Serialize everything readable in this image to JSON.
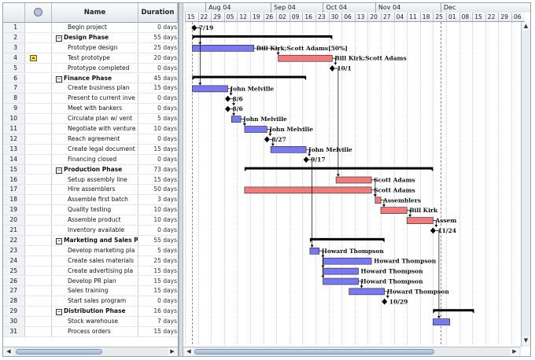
{
  "table": {
    "headers": {
      "name": "Name",
      "duration": "Duration",
      "info_icon": "info-icon"
    },
    "rows": [
      {
        "id": "1",
        "name": "Begin project",
        "duration": "0 days",
        "summary": false,
        "indent": 1,
        "note": false
      },
      {
        "id": "2",
        "name": "Design Phase",
        "duration": "55 days",
        "summary": true,
        "indent": 0,
        "note": false
      },
      {
        "id": "3",
        "name": "Prototype design",
        "duration": "25 days",
        "summary": false,
        "indent": 1,
        "note": false
      },
      {
        "id": "4",
        "name": "Test prototype",
        "duration": "20 days",
        "summary": false,
        "indent": 1,
        "note": true
      },
      {
        "id": "5",
        "name": "Prototype completed",
        "duration": "0 days",
        "summary": false,
        "indent": 1,
        "note": false
      },
      {
        "id": "6",
        "name": "Finance Phase",
        "duration": "45 days",
        "summary": true,
        "indent": 0,
        "note": false
      },
      {
        "id": "7",
        "name": "Create business plan",
        "duration": "15 days",
        "summary": false,
        "indent": 1,
        "note": false
      },
      {
        "id": "8",
        "name": "Present to current inve",
        "duration": "0 days",
        "summary": false,
        "indent": 1,
        "note": false
      },
      {
        "id": "9",
        "name": "Meet with bankers",
        "duration": "0 days",
        "summary": false,
        "indent": 1,
        "note": false
      },
      {
        "id": "10",
        "name": "Circulate plan w/ vent",
        "duration": "5 days",
        "summary": false,
        "indent": 1,
        "note": false
      },
      {
        "id": "11",
        "name": "Negotiate with venture",
        "duration": "10 days",
        "summary": false,
        "indent": 1,
        "note": false
      },
      {
        "id": "12",
        "name": "Reach agreement",
        "duration": "0 days",
        "summary": false,
        "indent": 1,
        "note": false
      },
      {
        "id": "13",
        "name": "Create legal document",
        "duration": "15 days",
        "summary": false,
        "indent": 1,
        "note": false
      },
      {
        "id": "14",
        "name": "Financing closed",
        "duration": "0 days",
        "summary": false,
        "indent": 1,
        "note": false
      },
      {
        "id": "15",
        "name": "Production Phase",
        "duration": "73 days",
        "summary": true,
        "indent": 0,
        "note": false
      },
      {
        "id": "16",
        "name": "Setup assembly line",
        "duration": "15 days",
        "summary": false,
        "indent": 1,
        "note": false
      },
      {
        "id": "17",
        "name": "Hire assemblers",
        "duration": "50 days",
        "summary": false,
        "indent": 1,
        "note": false
      },
      {
        "id": "18",
        "name": "Assemble first batch",
        "duration": "3 days",
        "summary": false,
        "indent": 1,
        "note": false
      },
      {
        "id": "19",
        "name": "Quality testing",
        "duration": "10 days",
        "summary": false,
        "indent": 1,
        "note": false
      },
      {
        "id": "20",
        "name": "Assemble product",
        "duration": "10 days",
        "summary": false,
        "indent": 1,
        "note": false
      },
      {
        "id": "21",
        "name": "Inventory available",
        "duration": "0 days",
        "summary": false,
        "indent": 1,
        "note": false
      },
      {
        "id": "22",
        "name": "Marketing and Sales P",
        "duration": "55 days",
        "summary": true,
        "indent": 0,
        "note": false
      },
      {
        "id": "23",
        "name": "Develop marketing pla",
        "duration": "5 days",
        "summary": false,
        "indent": 1,
        "note": false
      },
      {
        "id": "24",
        "name": "Create sales materials",
        "duration": "25 days",
        "summary": false,
        "indent": 1,
        "note": false
      },
      {
        "id": "25",
        "name": "Create advertising pla",
        "duration": "15 days",
        "summary": false,
        "indent": 1,
        "note": false
      },
      {
        "id": "26",
        "name": "Develop PR plan",
        "duration": "15 days",
        "summary": false,
        "indent": 1,
        "note": false
      },
      {
        "id": "27",
        "name": "Sales training",
        "duration": "15 days",
        "summary": false,
        "indent": 1,
        "note": false
      },
      {
        "id": "28",
        "name": "Start sales program",
        "duration": "0 days",
        "summary": false,
        "indent": 1,
        "note": false
      },
      {
        "id": "29",
        "name": "Distribution Phase",
        "duration": "16 days",
        "summary": true,
        "indent": 0,
        "note": false
      },
      {
        "id": "30",
        "name": "Stock warehouse",
        "duration": "7 days",
        "summary": false,
        "indent": 1,
        "note": false
      },
      {
        "id": "31",
        "name": "Process orders",
        "duration": "15 days",
        "summary": false,
        "indent": 1,
        "note": false
      }
    ]
  },
  "timescale": {
    "months": [
      {
        "label": "Aug 04",
        "start": "2004-07-26"
      },
      {
        "label": "Sep 04",
        "start": "2004-08-30"
      },
      {
        "label": "Oct 04",
        "start": "2004-09-27"
      },
      {
        "label": "Nov 04",
        "start": "2004-10-25"
      },
      {
        "label": "Dec",
        "start": "2004-11-29"
      }
    ],
    "weeks": [
      "15",
      "22",
      "29",
      "05",
      "12",
      "19",
      "26",
      "02",
      "09",
      "16",
      "23",
      "30",
      "06",
      "13",
      "20",
      "27",
      "04",
      "11",
      "18",
      "25",
      "01",
      "08",
      "15",
      "22",
      "29",
      "06"
    ],
    "week_start": "2004-07-15",
    "today_line": "2004-07-19",
    "cursor_line": "2004-11-29"
  },
  "gantt": {
    "colors": {
      "critical": "#f07b7b",
      "noncritical": "#7878f2",
      "summary": "#000000",
      "link": "#000000"
    },
    "bars": [
      {
        "row": 1,
        "kind": "milestone",
        "date": "2004-07-19",
        "label": "7/19"
      },
      {
        "row": 2,
        "kind": "summary",
        "start": "2004-07-19",
        "end": "2004-10-01"
      },
      {
        "row": 3,
        "kind": "task",
        "critical": false,
        "start": "2004-07-19",
        "end": "2004-08-20",
        "label": "Bill Kirk;Scott Adams[50%]"
      },
      {
        "row": 4,
        "kind": "task",
        "critical": true,
        "start": "2004-09-03",
        "end": "2004-10-01",
        "label": "Bill Kirk;Scott Adams"
      },
      {
        "row": 5,
        "kind": "milestone",
        "date": "2004-10-01",
        "label": "10/1"
      },
      {
        "row": 6,
        "kind": "summary",
        "start": "2004-07-19",
        "end": "2004-09-17"
      },
      {
        "row": 7,
        "kind": "task",
        "critical": false,
        "start": "2004-07-19",
        "end": "2004-08-06",
        "label": "John Melville"
      },
      {
        "row": 8,
        "kind": "milestone",
        "date": "2004-08-06",
        "label": "8/6"
      },
      {
        "row": 9,
        "kind": "milestone",
        "date": "2004-08-06",
        "label": "8/6"
      },
      {
        "row": 10,
        "kind": "task",
        "critical": false,
        "start": "2004-08-09",
        "end": "2004-08-13",
        "label": "John Melville"
      },
      {
        "row": 11,
        "kind": "task",
        "critical": false,
        "start": "2004-08-16",
        "end": "2004-08-27",
        "label": "John Melville"
      },
      {
        "row": 12,
        "kind": "milestone",
        "date": "2004-08-27",
        "label": "8/27"
      },
      {
        "row": 13,
        "kind": "task",
        "critical": false,
        "start": "2004-08-30",
        "end": "2004-09-17",
        "label": "John Melville"
      },
      {
        "row": 14,
        "kind": "milestone",
        "date": "2004-09-17",
        "label": "9/17"
      },
      {
        "row": 15,
        "kind": "summary",
        "start": "2004-08-16",
        "end": "2004-11-24"
      },
      {
        "row": 16,
        "kind": "task",
        "critical": true,
        "start": "2004-10-04",
        "end": "2004-10-22",
        "label": "Scott Adams"
      },
      {
        "row": 17,
        "kind": "task",
        "critical": true,
        "start": "2004-08-16",
        "end": "2004-10-22",
        "label": "Scott Adams"
      },
      {
        "row": 18,
        "kind": "task",
        "critical": true,
        "start": "2004-10-25",
        "end": "2004-10-27",
        "label": "Assemblers"
      },
      {
        "row": 19,
        "kind": "task",
        "critical": true,
        "start": "2004-10-28",
        "end": "2004-11-10",
        "label": "Bill Kirk"
      },
      {
        "row": 20,
        "kind": "task",
        "critical": true,
        "start": "2004-11-11",
        "end": "2004-11-24",
        "label": "Assem"
      },
      {
        "row": 21,
        "kind": "milestone",
        "date": "2004-11-24",
        "label": "11/24"
      },
      {
        "row": 22,
        "kind": "summary",
        "start": "2004-09-20",
        "end": "2004-10-29"
      },
      {
        "row": 23,
        "kind": "task",
        "critical": false,
        "start": "2004-09-20",
        "end": "2004-09-24",
        "label": "Howard Thompson"
      },
      {
        "row": 24,
        "kind": "task",
        "critical": false,
        "start": "2004-09-27",
        "end": "2004-10-22",
        "label": "Howard Thompson"
      },
      {
        "row": 25,
        "kind": "task",
        "critical": false,
        "start": "2004-09-27",
        "end": "2004-10-15",
        "label": "Howard Thompson"
      },
      {
        "row": 26,
        "kind": "task",
        "critical": false,
        "start": "2004-09-27",
        "end": "2004-10-15",
        "label": "Howard Thompson"
      },
      {
        "row": 27,
        "kind": "task",
        "critical": false,
        "start": "2004-10-11",
        "end": "2004-10-29",
        "label": "Howard Thompson"
      },
      {
        "row": 28,
        "kind": "milestone",
        "date": "2004-10-29",
        "label": "10/29"
      },
      {
        "row": 29,
        "kind": "summary",
        "start": "2004-11-25",
        "end": "2004-12-16"
      },
      {
        "row": 30,
        "kind": "task",
        "critical": false,
        "start": "2004-11-25",
        "end": "2004-12-03",
        "label": ""
      }
    ],
    "links": [
      {
        "from": 1,
        "to": 3
      },
      {
        "from": 3,
        "to": 4
      },
      {
        "from": 4,
        "to": 5
      },
      {
        "from": 1,
        "to": 7
      },
      {
        "from": 7,
        "to": 8
      },
      {
        "from": 8,
        "to": 9
      },
      {
        "from": 9,
        "to": 10
      },
      {
        "from": 10,
        "to": 11
      },
      {
        "from": 11,
        "to": 12
      },
      {
        "from": 12,
        "to": 13
      },
      {
        "from": 13,
        "to": 14
      },
      {
        "from": 5,
        "to": 16
      },
      {
        "from": 16,
        "to": 18
      },
      {
        "from": 17,
        "to": 18
      },
      {
        "from": 18,
        "to": 19
      },
      {
        "from": 19,
        "to": 20
      },
      {
        "from": 20,
        "to": 21
      },
      {
        "from": 14,
        "to": 23
      },
      {
        "from": 23,
        "to": 24
      },
      {
        "from": 23,
        "to": 25
      },
      {
        "from": 23,
        "to": 26
      },
      {
        "from": 26,
        "to": 27
      },
      {
        "from": 27,
        "to": 28
      },
      {
        "from": 21,
        "to": 30
      }
    ]
  }
}
